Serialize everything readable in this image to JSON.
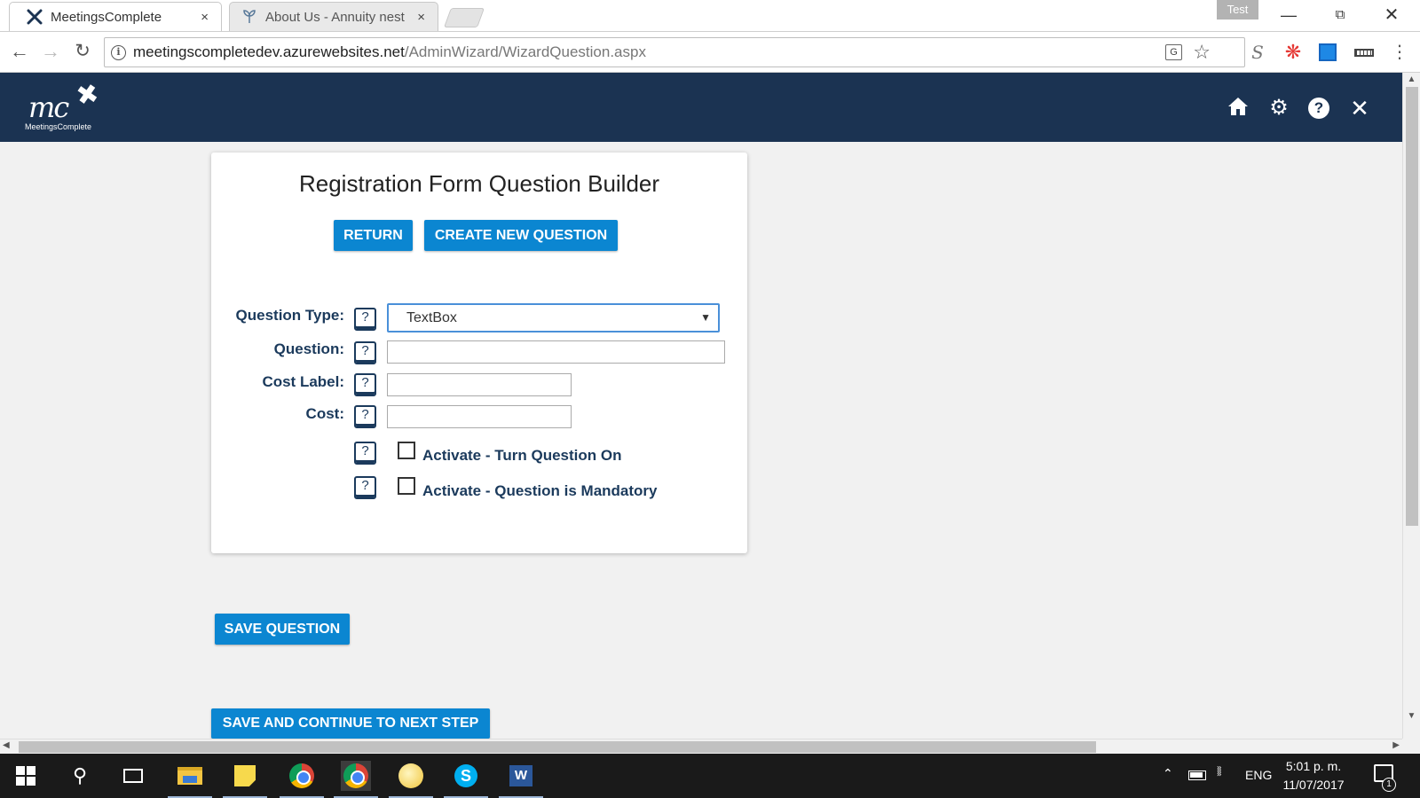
{
  "browser": {
    "tabs": [
      {
        "title": "MeetingsComplete",
        "icon": "meetingscomplete-favicon",
        "close": "×"
      },
      {
        "title": "About Us - Annuity nest",
        "icon": "annuity-nest-favicon",
        "close": "×"
      }
    ],
    "profile_badge": "Test",
    "url_host": "meetingscompletedev.azurewebsites.net",
    "url_path": "/AdminWizard/WizardQuestion.aspx"
  },
  "app_header": {
    "logo_mark": "mc",
    "logo_text": "MeetingsComplete",
    "icons": [
      "home-icon",
      "settings-icon",
      "help-icon",
      "close-icon"
    ]
  },
  "builder": {
    "title": "Registration Form Question Builder",
    "return_label": "RETURN",
    "create_label": "CREATE NEW QUESTION",
    "help_glyph": "?",
    "fields": {
      "question_type_label": "Question Type:",
      "question_type_value": "TextBox",
      "question_label": "Question:",
      "question_value": "",
      "cost_label_label": "Cost Label:",
      "cost_label_value": "",
      "cost_label_text": "Cost:",
      "cost_value": ""
    },
    "checkboxes": [
      {
        "label": "Activate - Turn Question On",
        "checked": false
      },
      {
        "label": "Activate - Question is Mandatory",
        "checked": false
      }
    ],
    "save_label": "SAVE QUESTION",
    "save_continue_label": "SAVE AND CONTINUE TO NEXT STEP"
  },
  "taskbar": {
    "apps": [
      "windows-start",
      "search",
      "task-view",
      "file-explorer",
      "sticky-notes",
      "chrome",
      "chrome",
      "app",
      "skype",
      "word"
    ],
    "tray_lang": "ENG",
    "time": "5:01 p. m.",
    "date": "11/07/2017",
    "notifications": "1"
  },
  "colors": {
    "header_bg": "#1b3352",
    "button_blue": "#0b86d1",
    "label_navy": "#1b3a5c"
  }
}
